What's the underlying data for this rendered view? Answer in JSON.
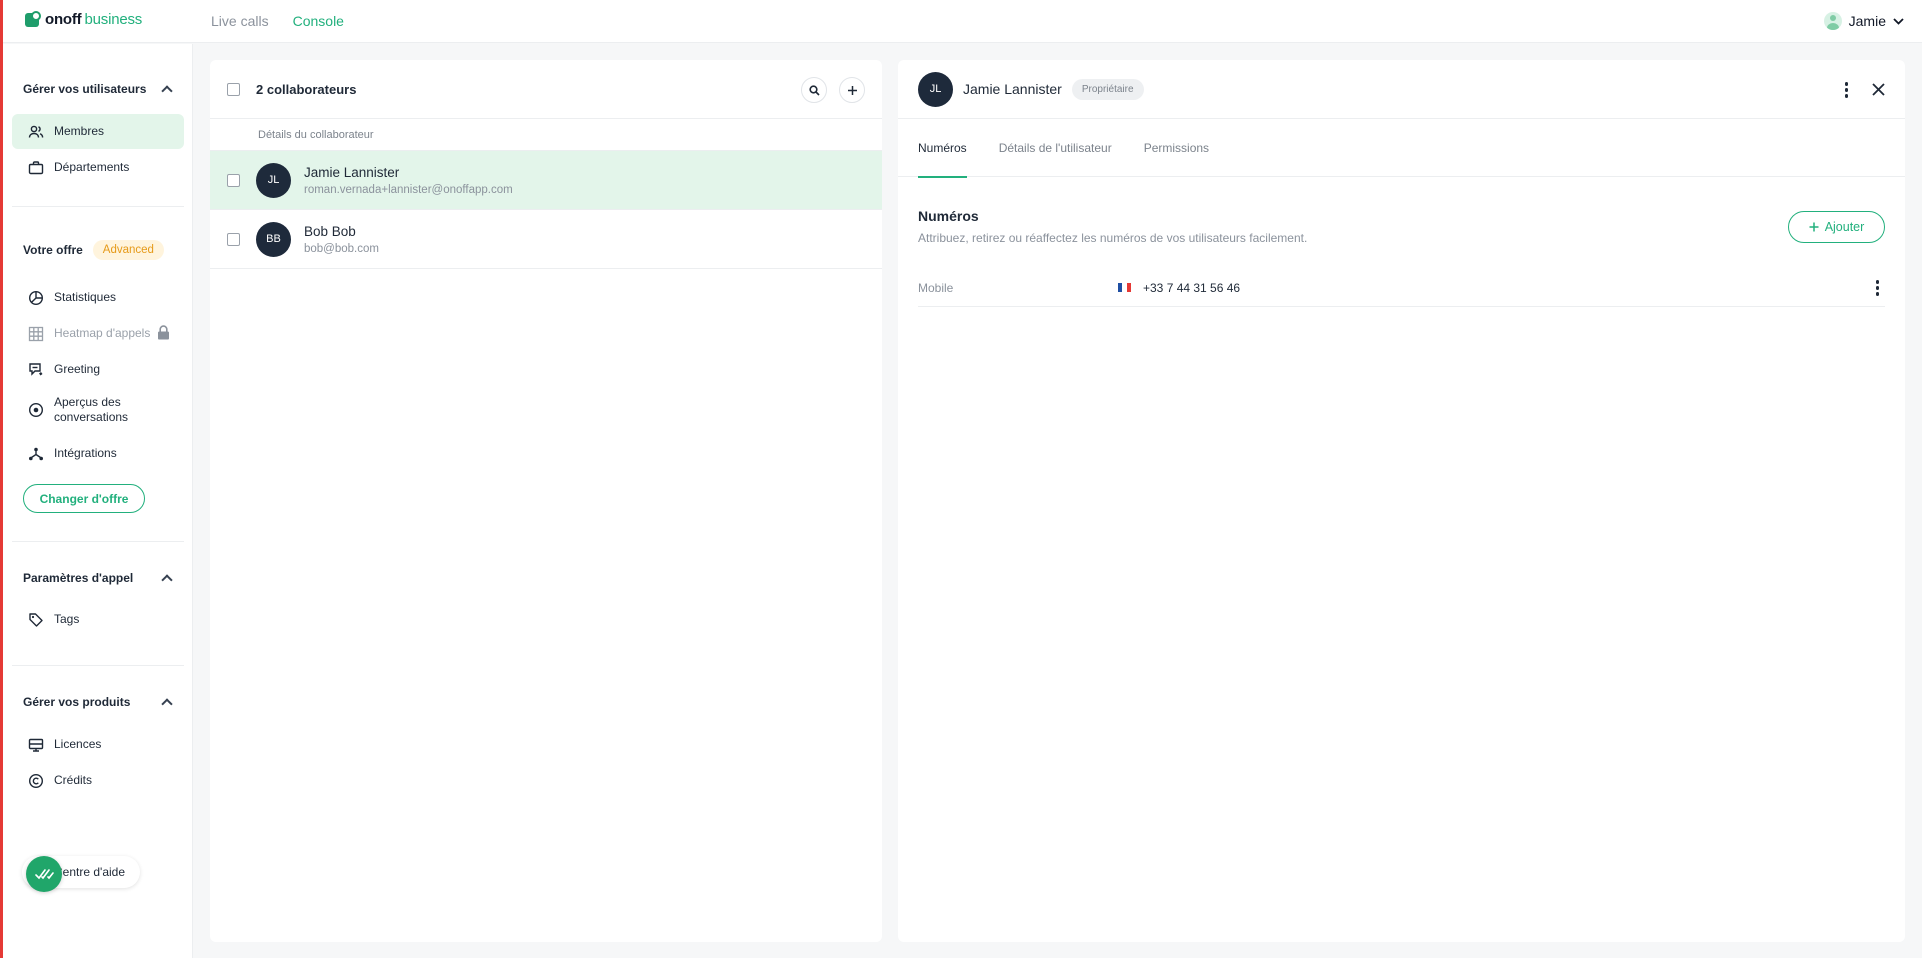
{
  "app": {
    "logo_main": "onoff",
    "logo_sub": "business",
    "nav": [
      "Live calls",
      "Console"
    ],
    "active_nav": "Console",
    "user_name": "Jamie"
  },
  "sidebar": {
    "section_users": "Gérer vos utilisateurs",
    "users_items": [
      {
        "label": "Membres",
        "icon": "users-icon",
        "active": true
      },
      {
        "label": "Départements",
        "icon": "briefcase-icon"
      }
    ],
    "offer_label": "Votre offre",
    "offer_badge": "Advanced",
    "offer_items": [
      {
        "label": "Statistiques",
        "icon": "chart-pie-icon"
      },
      {
        "label": "Heatmap d'appels",
        "icon": "grid-icon",
        "disabled": true,
        "locked": true
      },
      {
        "label": "Greeting",
        "icon": "greeting-icon"
      },
      {
        "label": "Aperçus des conversations",
        "icon": "record-icon"
      },
      {
        "label": "Intégrations",
        "icon": "integrations-icon"
      }
    ],
    "change_offer_button": "Changer d'offre",
    "section_call_settings": "Paramètres d'appel",
    "call_items": [
      {
        "label": "Tags",
        "icon": "tag-icon"
      }
    ],
    "section_products": "Gérer vos produits",
    "product_items": [
      {
        "label": "Licences",
        "icon": "license-icon"
      },
      {
        "label": "Crédits",
        "icon": "copyright-icon"
      }
    ],
    "help_label": "Centre d'aide"
  },
  "members_panel": {
    "title": "2 collaborateurs",
    "column_header": "Détails du collaborateur",
    "rows": [
      {
        "initials": "JL",
        "name": "Jamie Lannister",
        "email": "roman.vernada+lannister@onoffapp.com",
        "selected": true
      },
      {
        "initials": "BB",
        "name": "Bob Bob",
        "email": "bob@bob.com",
        "selected": false
      }
    ]
  },
  "detail_panel": {
    "initials": "JL",
    "name": "Jamie Lannister",
    "role_badge": "Propriétaire",
    "tabs": [
      "Numéros",
      "Détails de l'utilisateur",
      "Permissions"
    ],
    "active_tab": "Numéros",
    "section_title": "Numéros",
    "section_subtitle": "Attribuez, retirez ou réaffectez les numéros de vos utilisateurs facilement.",
    "add_button": "Ajouter",
    "numbers": [
      {
        "type": "Mobile",
        "country": "FR",
        "number": "+33 7 44 31 56 46"
      }
    ]
  },
  "colors": {
    "accent": "#22b07d",
    "selected_row": "#e3f5ea",
    "avatar_bg": "#1e2a3b",
    "badge_advanced_bg": "#fff4dd",
    "badge_advanced_fg": "#e69a19"
  }
}
